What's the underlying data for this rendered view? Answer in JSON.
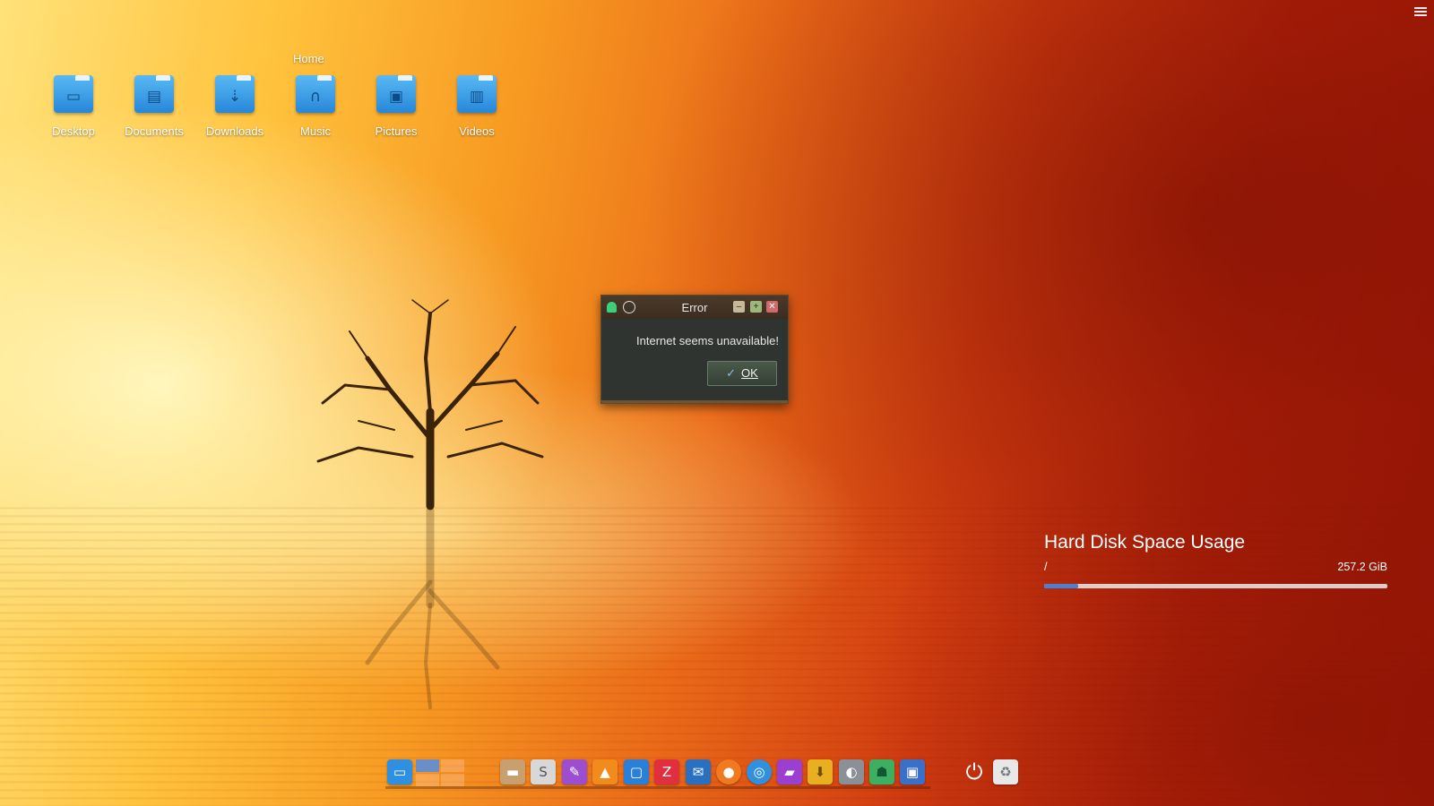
{
  "desktop": {
    "group_label": "Home",
    "icons": [
      {
        "label": "Desktop",
        "icon": "desktop-folder-icon"
      },
      {
        "label": "Documents",
        "icon": "documents-folder-icon"
      },
      {
        "label": "Downloads",
        "icon": "downloads-folder-icon"
      },
      {
        "label": "Music",
        "icon": "music-folder-icon"
      },
      {
        "label": "Pictures",
        "icon": "pictures-folder-icon"
      },
      {
        "label": "Videos",
        "icon": "videos-folder-icon"
      }
    ]
  },
  "dialog": {
    "title": "Error",
    "message": "Internet seems unavailable!",
    "ok_label": "OK"
  },
  "hdd_widget": {
    "title": "Hard Disk Space Usage",
    "mount": "/",
    "size": "257.2 GiB",
    "used_fraction": 0.1
  },
  "dock": {
    "items": [
      {
        "icon": "show-desktop-icon",
        "color": "#2f8fe0"
      },
      {
        "icon": "file-manager-icon",
        "color": "#c8a070"
      },
      {
        "icon": "text-editor-icon",
        "color": "#d8d8d8"
      },
      {
        "icon": "paint-brush-icon",
        "color": "#9b4fd0"
      },
      {
        "icon": "vlc-cone-icon",
        "color": "#f28a1c"
      },
      {
        "icon": "software-center-icon",
        "color": "#2a80d8"
      },
      {
        "icon": "filezilla-icon",
        "color": "#e03040"
      },
      {
        "icon": "mail-icon",
        "color": "#2a70c0"
      },
      {
        "icon": "firefox-icon",
        "color": "#f07a20"
      },
      {
        "icon": "browser-icon",
        "color": "#2f8fe0"
      },
      {
        "icon": "chat-icon",
        "color": "#9b3fd0"
      },
      {
        "icon": "download-manager-icon",
        "color": "#e8b020"
      },
      {
        "icon": "toggle-settings-icon",
        "color": "#8a8f98"
      },
      {
        "icon": "ghost-app-icon",
        "color": "#3cb060"
      },
      {
        "icon": "screenshot-icon",
        "color": "#3a70c8"
      },
      {
        "icon": "power-icon",
        "color": "transparent"
      },
      {
        "icon": "trash-icon",
        "color": "#e8e8e8"
      }
    ]
  }
}
